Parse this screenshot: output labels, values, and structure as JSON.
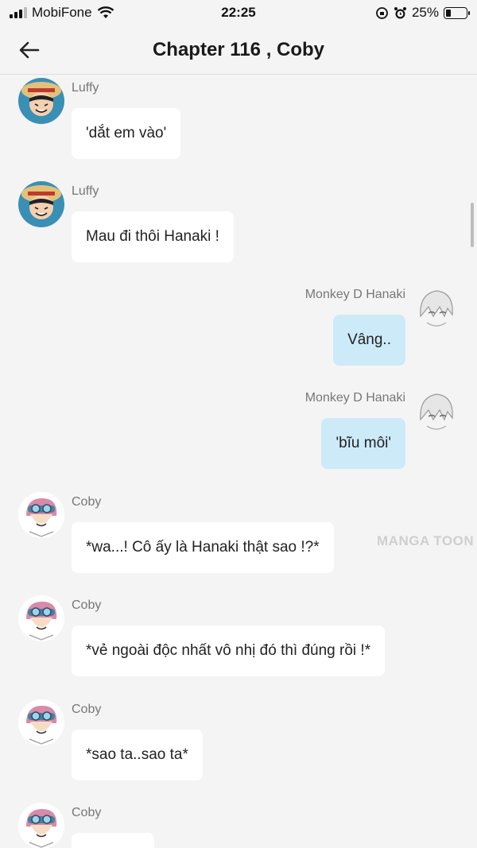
{
  "status": {
    "carrier": "MobiFone",
    "time": "22:25",
    "battery_percent": "25%",
    "battery_level": 0.25
  },
  "header": {
    "title": "Chapter 116 , Coby"
  },
  "watermark": "MANGA TOON",
  "messages": [
    {
      "sender": "Luffy",
      "text": "'dắt em vào'"
    },
    {
      "sender": "Luffy",
      "text": "Mau đi thôi Hanaki !"
    },
    {
      "sender": "Monkey D Hanaki",
      "text": "Vâng.."
    },
    {
      "sender": "Monkey D Hanaki",
      "text": "'bĩu môi'"
    },
    {
      "sender": "Coby",
      "text": "*wa...! Cô ấy là Hanaki thật sao !?*"
    },
    {
      "sender": "Coby",
      "text": "*vẻ ngoài độc nhất vô nhị đó thì đúng rồi !*"
    },
    {
      "sender": "Coby",
      "text": "*sao ta..sao ta*"
    },
    {
      "sender": "Coby",
      "text": ""
    }
  ]
}
